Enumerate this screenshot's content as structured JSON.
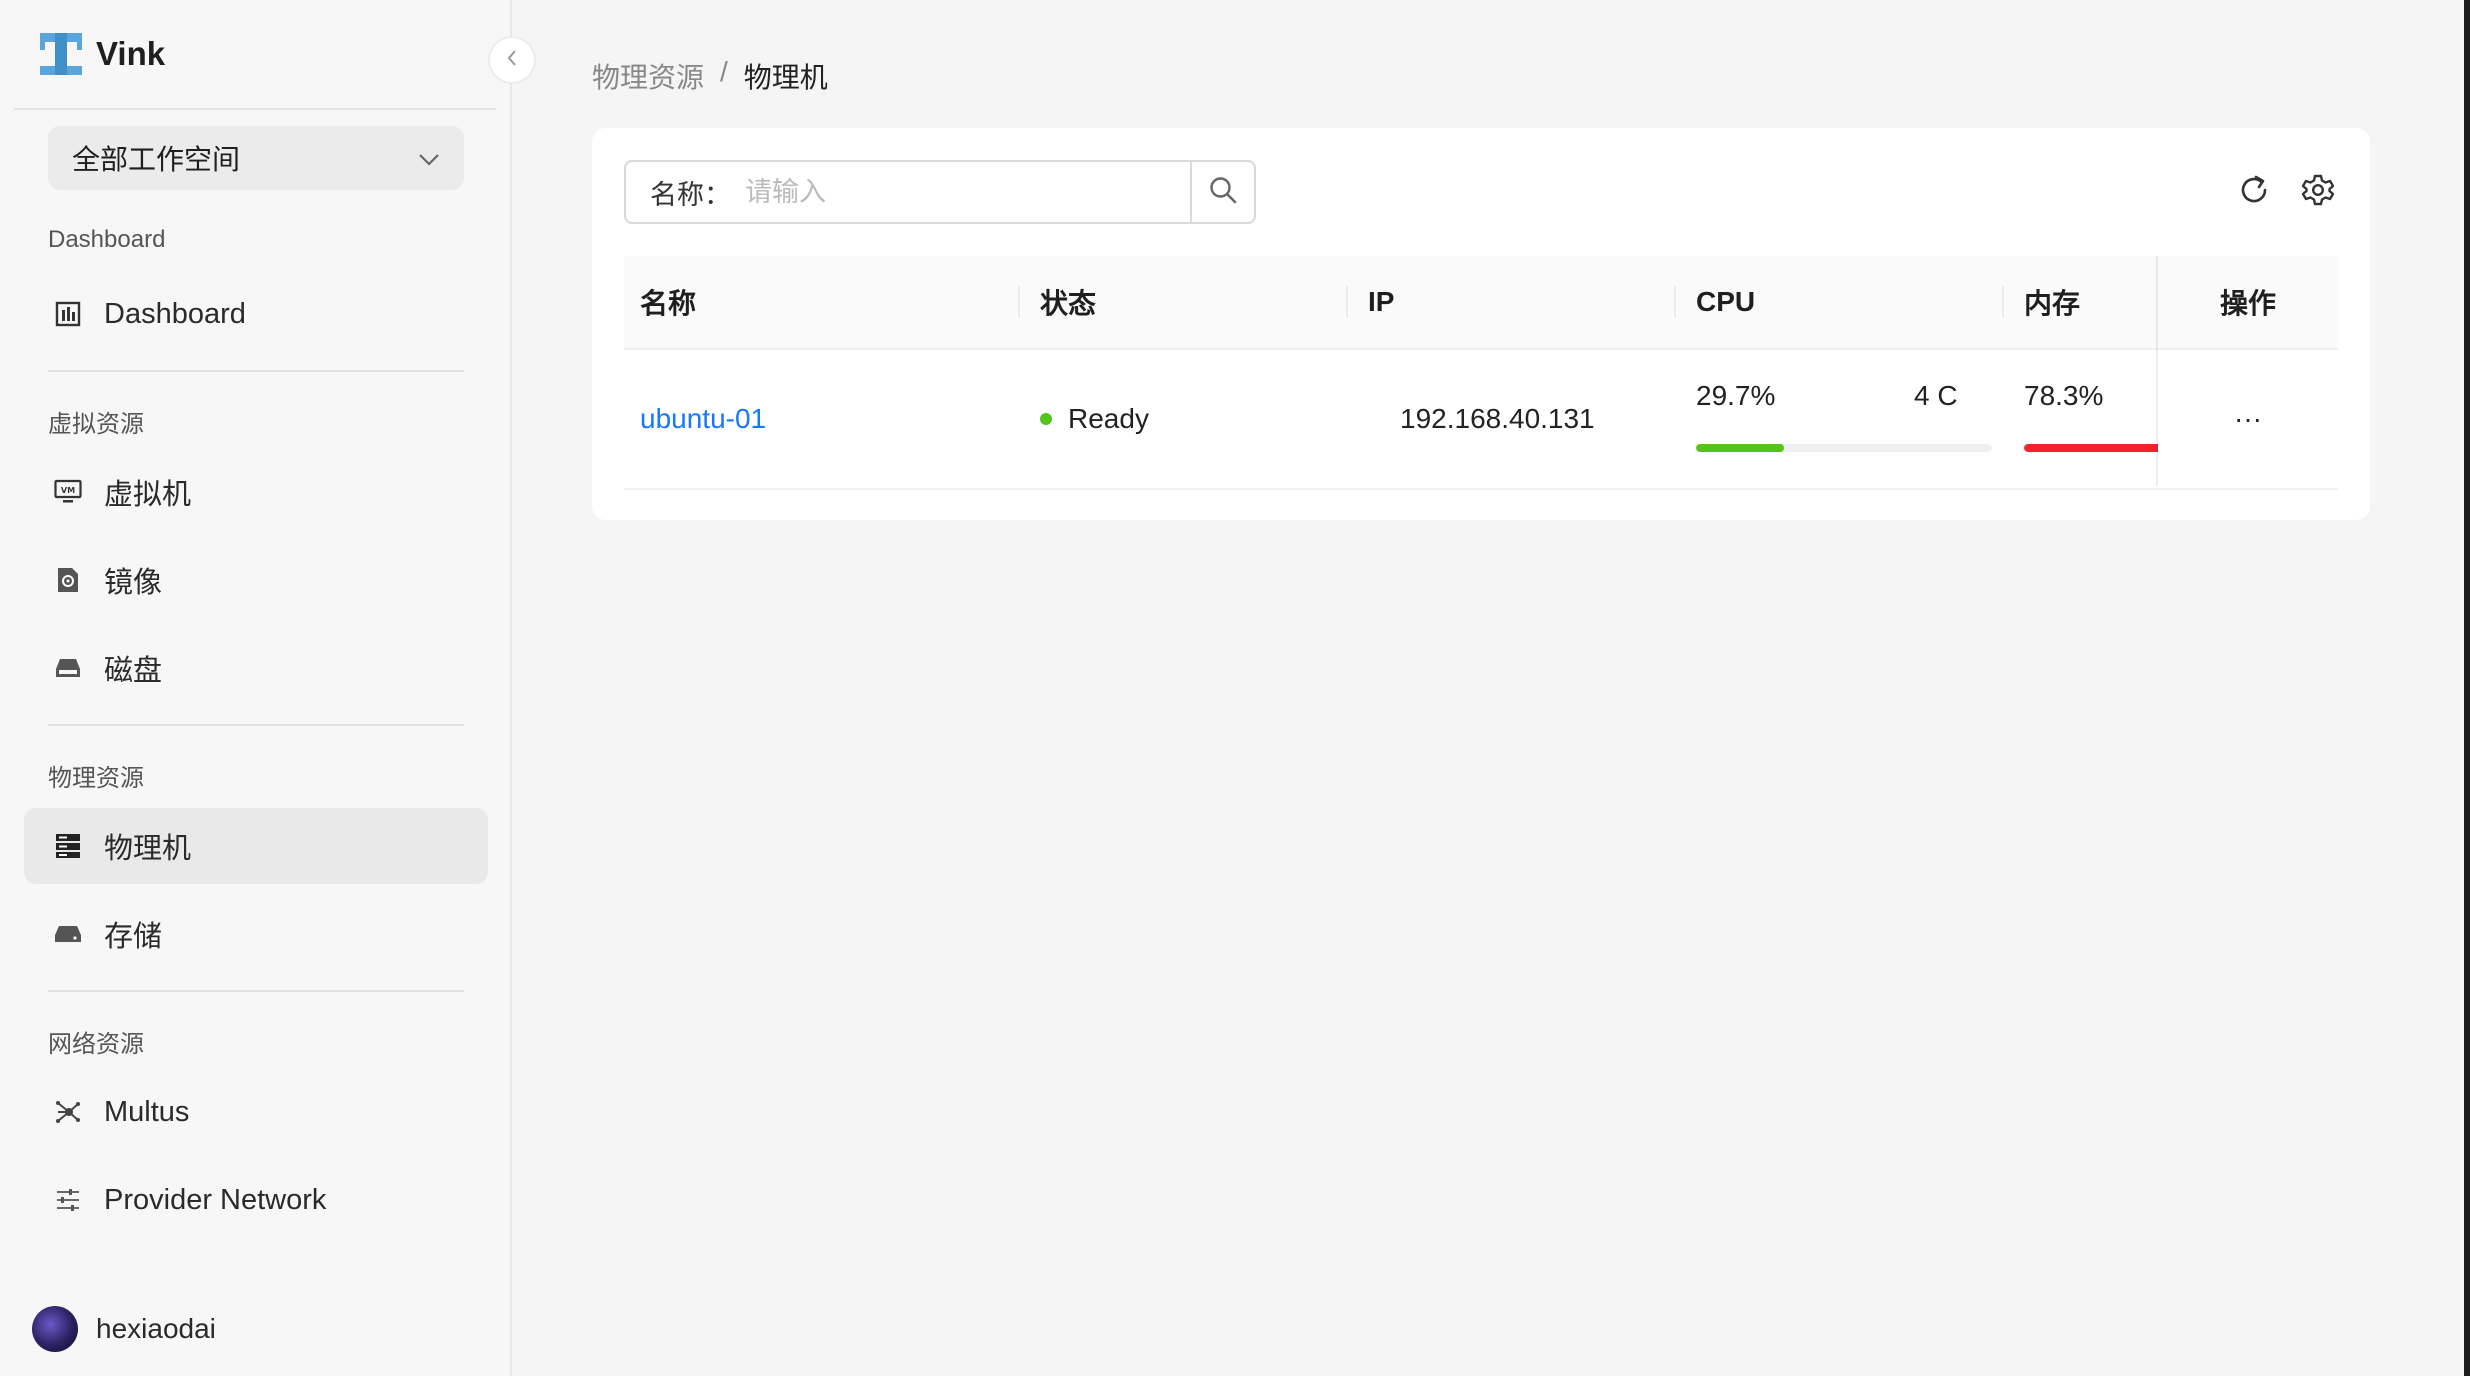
{
  "app": {
    "name": "Vink"
  },
  "sidebar": {
    "workspace": "全部工作空间",
    "groups": {
      "dashboard": "Dashboard",
      "virtual": "虚拟资源",
      "physical": "物理资源",
      "network": "网络资源"
    },
    "items": {
      "dashboard": "Dashboard",
      "vm": "虚拟机",
      "image": "镜像",
      "disk": "磁盘",
      "host": "物理机",
      "storage": "存储",
      "multus": "Multus",
      "provider_network": "Provider Network"
    },
    "active": "host",
    "user": "hexiaodai"
  },
  "breadcrumb": {
    "parent": "物理资源",
    "current": "物理机"
  },
  "search": {
    "label": "名称：",
    "placeholder": "请输入"
  },
  "table": {
    "columns": {
      "name": "名称",
      "status": "状态",
      "ip": "IP",
      "cpu": "CPU",
      "memory": "内存",
      "actions": "操作"
    },
    "rows": [
      {
        "name": "ubuntu-01",
        "status": "Ready",
        "ip": "192.168.40.131",
        "cpu_percent": "29.7%",
        "cpu_cores": "4 C",
        "cpu_fraction": 0.297,
        "memory_percent": "78.3%",
        "memory_fraction": 0.783,
        "actions": "···"
      }
    ]
  },
  "colors": {
    "accent": "#1677ff",
    "status_ready": "#52c41a",
    "cpu_bar": "#52c41a",
    "memory_bar": "#f5222d",
    "logo": "#4a9fd8"
  }
}
